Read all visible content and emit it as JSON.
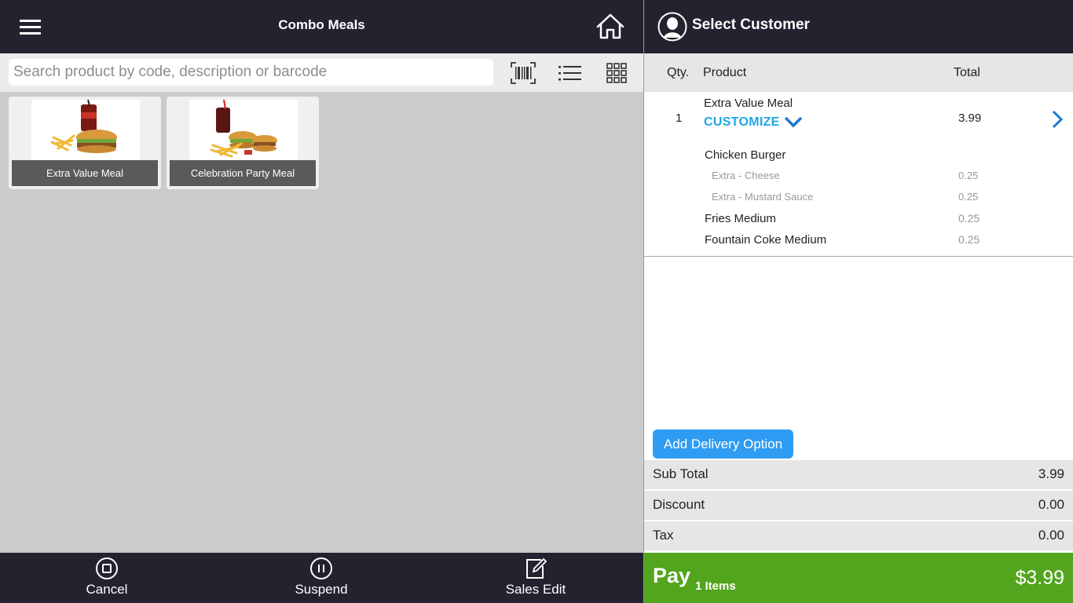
{
  "header": {
    "category_title": "Combo Meals"
  },
  "search": {
    "placeholder": "Search product by code, description or barcode"
  },
  "products": [
    {
      "name": "Extra Value Meal"
    },
    {
      "name": "Celebration Party Meal"
    }
  ],
  "footer": {
    "cancel_label": "Cancel",
    "suspend_label": "Suspend",
    "sales_edit_label": "Sales Edit"
  },
  "customer": {
    "title": "Select Customer"
  },
  "order_table": {
    "headers": {
      "qty": "Qty.",
      "product": "Product",
      "total": "Total"
    },
    "line": {
      "qty": "1",
      "name": "Extra Value Meal",
      "customize": "CUSTOMIZE",
      "total": "3.99",
      "components": [
        {
          "name": "Chicken Burger",
          "price": ""
        },
        {
          "name": "Fries Medium",
          "price": "0.25"
        },
        {
          "name": "Fountain Coke Medium",
          "price": "0.25"
        }
      ],
      "modifiers": [
        {
          "name": "Extra - Cheese",
          "price": "0.25"
        },
        {
          "name": "Extra - Mustard Sauce",
          "price": "0.25"
        }
      ]
    }
  },
  "delivery": {
    "label": "Add Delivery Option"
  },
  "summary": {
    "subtotal_label": "Sub Total",
    "subtotal": "3.99",
    "discount_label": "Discount",
    "discount": "0.00",
    "tax_label": "Tax",
    "tax": "0.00"
  },
  "pay": {
    "label": "Pay",
    "items": "1 Items",
    "total": "$3.99"
  },
  "colors": {
    "header_bg": "#23222f",
    "accent_blue": "#1da6e6",
    "delivery_blue": "#2f9cf3",
    "pay_green": "#52a51c"
  }
}
